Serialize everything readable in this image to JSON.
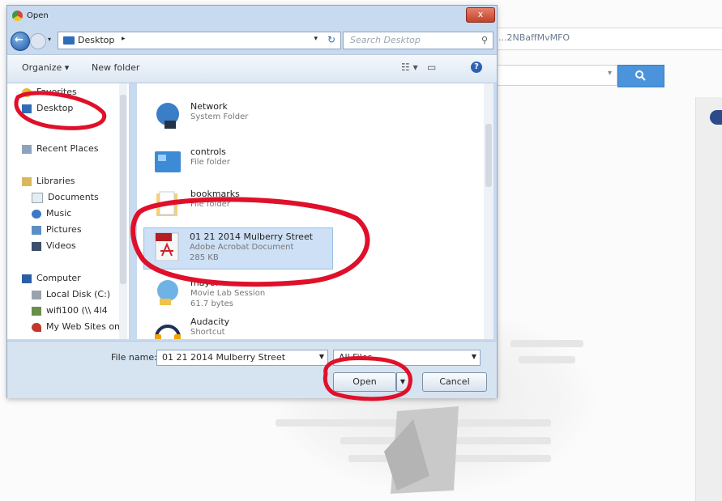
{
  "browser": {
    "url_text": "...2NBaffMvMFO"
  },
  "dialog": {
    "title": "Open",
    "close_label": "x",
    "address": {
      "folder": "Desktop"
    },
    "search_placeholder": "Search Desktop",
    "toolbar": {
      "organize": "Organize ▾",
      "new_folder": "New folder"
    },
    "nav": {
      "favorites": [
        {
          "label": "Favorites",
          "icon": "star-icon"
        },
        {
          "label": "Desktop",
          "icon": "desktop-icon"
        },
        {
          "label": "Recent Places",
          "icon": "recent-places-icon"
        }
      ],
      "libraries": [
        {
          "label": "Libraries",
          "icon": "library-icon"
        },
        {
          "label": "Documents",
          "icon": "documents-icon"
        },
        {
          "label": "Music",
          "icon": "music-icon"
        },
        {
          "label": "Pictures",
          "icon": "pictures-icon"
        },
        {
          "label": "Videos",
          "icon": "videos-icon"
        }
      ],
      "computer": [
        {
          "label": "Computer",
          "icon": "computer-icon"
        },
        {
          "label": "Local Disk (C:)",
          "icon": "disk-icon"
        },
        {
          "label": "wifi100 (\\\\ 4l4",
          "icon": "network-drive-icon"
        },
        {
          "label": "My Web Sites on",
          "icon": "web-sites-icon"
        }
      ]
    },
    "files": [
      {
        "name": "Network",
        "type": "System Folder",
        "size": "",
        "icon": "network-icon"
      },
      {
        "name": "controls",
        "type": "File folder",
        "size": "",
        "icon": "control-panel-folder-icon"
      },
      {
        "name": "bookmarks",
        "type": "File folder",
        "size": "",
        "icon": "folder-icon"
      },
      {
        "name": "01 21 2014 Mulberry Street",
        "type": "Adobe Acrobat Document",
        "size": "285 KB",
        "icon": "pdf-icon",
        "selected": true
      },
      {
        "name": "mayor",
        "type": "Movie Lab Session",
        "size": "61.7 bytes",
        "icon": "media-file-icon"
      },
      {
        "name": "Audacity",
        "type": "Shortcut",
        "size": "",
        "icon": "audacity-shortcut-icon"
      }
    ],
    "filename_label": "File name:",
    "filename_value": "01 21 2014 Mulberry Street",
    "filetype_value": "All Files",
    "open_label": "Open",
    "cancel_label": "Cancel"
  },
  "annotation_color": "#e0102a"
}
